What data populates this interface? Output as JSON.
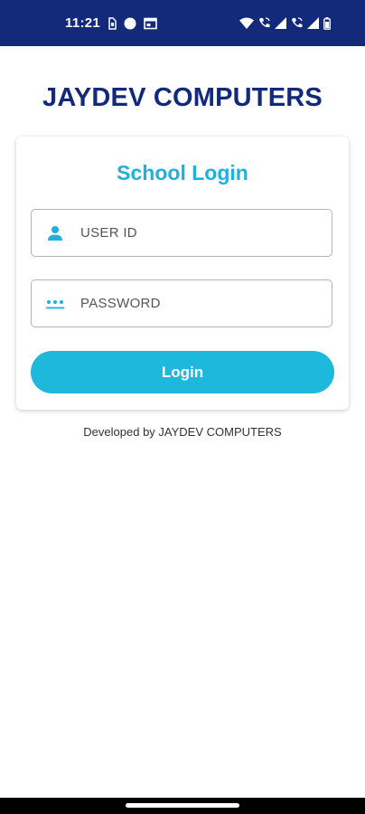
{
  "status_bar": {
    "time": "11:21",
    "left_icons": [
      "sim-icon",
      "circle-notification-icon",
      "calendar-icon"
    ],
    "right_icons": [
      "wifi-icon",
      "wifi-call-icon",
      "signal-icon",
      "wifi-call-icon",
      "signal-icon",
      "battery-icon"
    ]
  },
  "app": {
    "title": "JAYDEV COMPUTERS"
  },
  "login_card": {
    "title": "School Login",
    "user_id_placeholder": "USER ID",
    "password_placeholder": "PASSWORD",
    "login_label": "Login"
  },
  "footer": {
    "text": "Developed by JAYDEV COMPUTERS"
  },
  "colors": {
    "brand_navy": "#13297a",
    "accent_cyan": "#1fb8dd"
  }
}
